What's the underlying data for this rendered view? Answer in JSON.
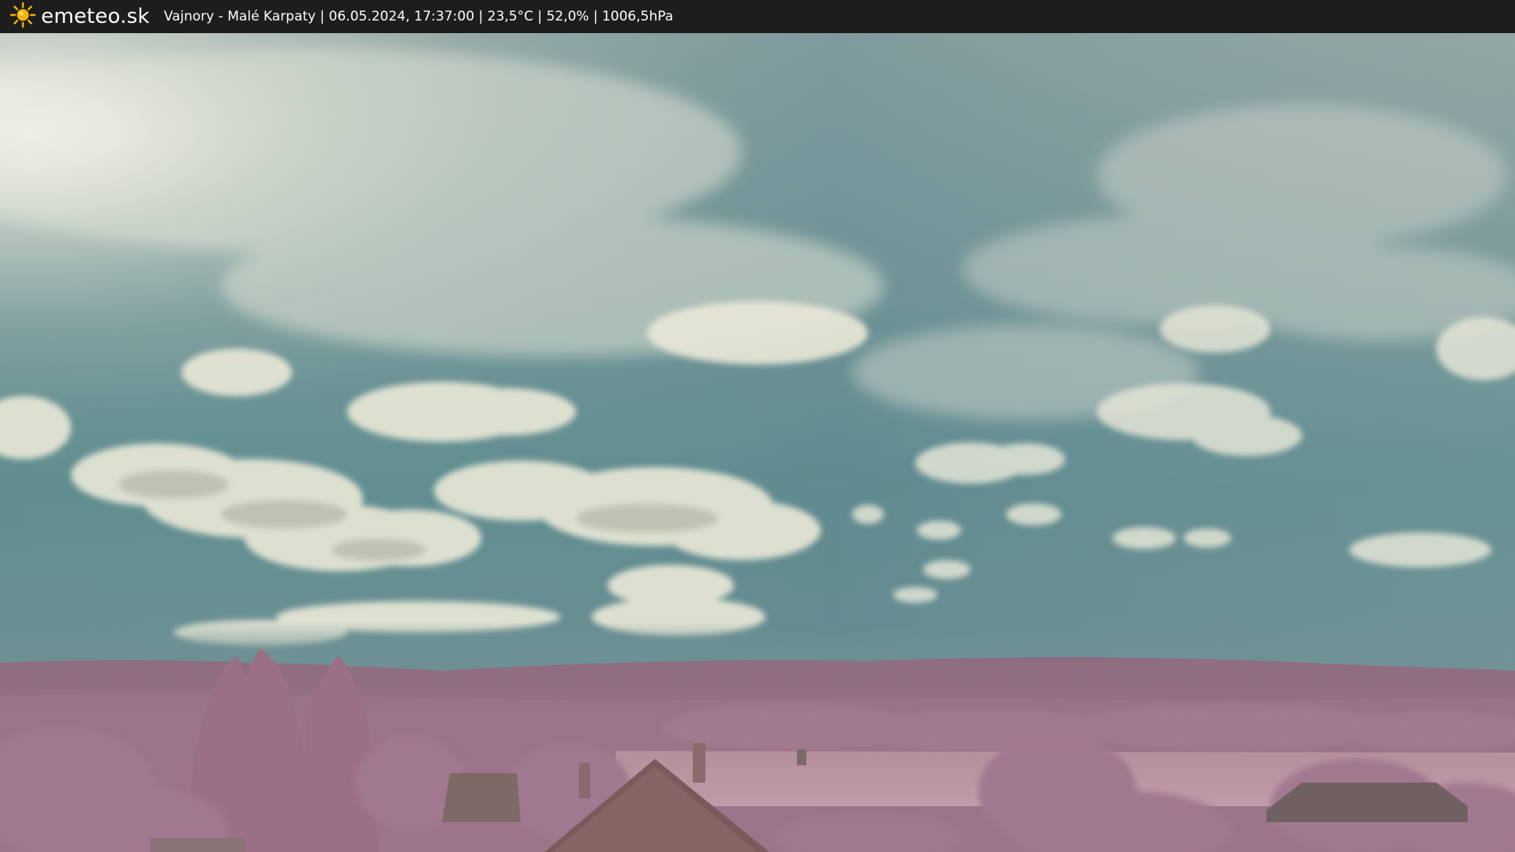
{
  "header": {
    "brand_icon": "sun-icon",
    "brand_name": "emeteo.sk",
    "caption": "Vajnory - Malé Karpaty | 06.05.2024, 17:37:00 | 23,5°C | 52,0% | 1006,5hPa"
  },
  "colors": {
    "bar_background": "#1d1d1d",
    "sun_icon": "#f5b400",
    "sky_top": "#8fa7a6",
    "sky_mid": "#5f8f90",
    "foliage": "#a67a93",
    "field": "#b8939f"
  }
}
